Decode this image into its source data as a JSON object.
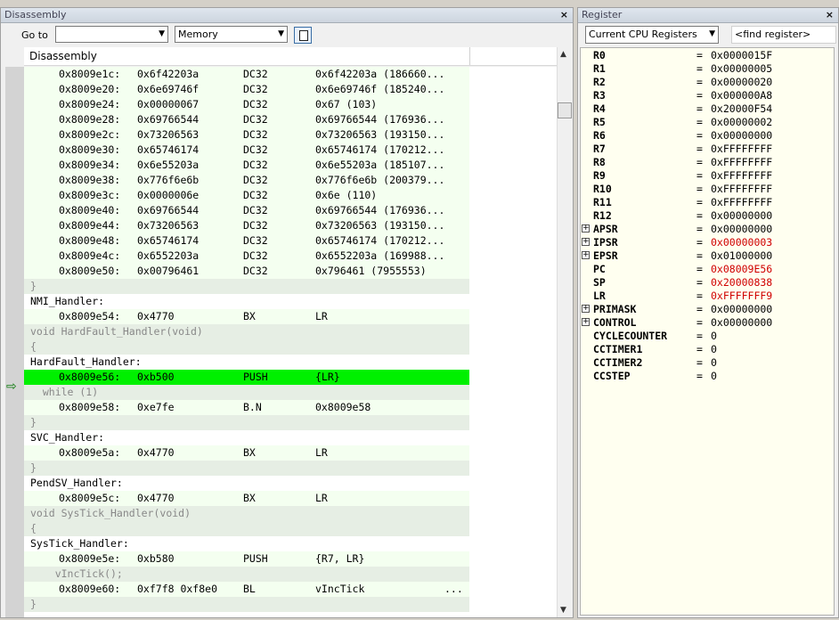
{
  "disassembly": {
    "title": "Disassembly",
    "goto_label": "Go to",
    "goto_value": "",
    "memory_combo": "Memory",
    "column_header": "Disassembly",
    "lines": [
      {
        "kind": "asm",
        "addr": "0x8009e1c:",
        "code": "0x6f42203a",
        "op": "DC32",
        "args": "0x6f42203a (186660..."
      },
      {
        "kind": "asm",
        "addr": "0x8009e20:",
        "code": "0x6e69746f",
        "op": "DC32",
        "args": "0x6e69746f (185240..."
      },
      {
        "kind": "asm",
        "addr": "0x8009e24:",
        "code": "0x00000067",
        "op": "DC32",
        "args": "0x67 (103)"
      },
      {
        "kind": "asm",
        "addr": "0x8009e28:",
        "code": "0x69766544",
        "op": "DC32",
        "args": "0x69766544 (176936..."
      },
      {
        "kind": "asm",
        "addr": "0x8009e2c:",
        "code": "0x73206563",
        "op": "DC32",
        "args": "0x73206563 (193150..."
      },
      {
        "kind": "asm",
        "addr": "0x8009e30:",
        "code": "0x65746174",
        "op": "DC32",
        "args": "0x65746174 (170212..."
      },
      {
        "kind": "asm",
        "addr": "0x8009e34:",
        "code": "0x6e55203a",
        "op": "DC32",
        "args": "0x6e55203a (185107..."
      },
      {
        "kind": "asm",
        "addr": "0x8009e38:",
        "code": "0x776f6e6b",
        "op": "DC32",
        "args": "0x776f6e6b (200379..."
      },
      {
        "kind": "asm",
        "addr": "0x8009e3c:",
        "code": "0x0000006e",
        "op": "DC32",
        "args": "0x6e (110)"
      },
      {
        "kind": "asm",
        "addr": "0x8009e40:",
        "code": "0x69766544",
        "op": "DC32",
        "args": "0x69766544 (176936..."
      },
      {
        "kind": "asm",
        "addr": "0x8009e44:",
        "code": "0x73206563",
        "op": "DC32",
        "args": "0x73206563 (193150..."
      },
      {
        "kind": "asm",
        "addr": "0x8009e48:",
        "code": "0x65746174",
        "op": "DC32",
        "args": "0x65746174 (170212..."
      },
      {
        "kind": "asm",
        "addr": "0x8009e4c:",
        "code": "0x6552203a",
        "op": "DC32",
        "args": "0x6552203a (169988..."
      },
      {
        "kind": "asm",
        "addr": "0x8009e50:",
        "code": "0x00796461",
        "op": "DC32",
        "args": "0x796461 (7955553)"
      },
      {
        "kind": "src",
        "text": "}"
      },
      {
        "kind": "lbl",
        "text": "NMI_Handler:"
      },
      {
        "kind": "asm",
        "addr": "0x8009e54:",
        "code": "0x4770",
        "op": "BX",
        "args": "LR"
      },
      {
        "kind": "src",
        "text": "void HardFault_Handler(void)"
      },
      {
        "kind": "src",
        "text": "{"
      },
      {
        "kind": "lbl",
        "text": "HardFault_Handler:"
      },
      {
        "kind": "cur",
        "addr": "0x8009e56:",
        "code": "0xb500",
        "op": "PUSH",
        "args": "{LR}"
      },
      {
        "kind": "src",
        "text": "  while (1)"
      },
      {
        "kind": "asm",
        "addr": "0x8009e58:",
        "code": "0xe7fe",
        "op": "B.N",
        "args": "0x8009e58"
      },
      {
        "kind": "src",
        "text": "}"
      },
      {
        "kind": "lbl",
        "text": "SVC_Handler:"
      },
      {
        "kind": "asm",
        "addr": "0x8009e5a:",
        "code": "0x4770",
        "op": "BX",
        "args": "LR"
      },
      {
        "kind": "src",
        "text": "}"
      },
      {
        "kind": "lbl",
        "text": "PendSV_Handler:"
      },
      {
        "kind": "asm",
        "addr": "0x8009e5c:",
        "code": "0x4770",
        "op": "BX",
        "args": "LR"
      },
      {
        "kind": "src",
        "text": "void SysTick_Handler(void)"
      },
      {
        "kind": "src",
        "text": "{"
      },
      {
        "kind": "lbl",
        "text": "SysTick_Handler:"
      },
      {
        "kind": "asm",
        "addr": "0x8009e5e:",
        "code": "0xb580",
        "op": "PUSH",
        "args": "{R7, LR}"
      },
      {
        "kind": "src",
        "text": "    vIncTick();"
      },
      {
        "kind": "asm",
        "addr": "0x8009e60:",
        "code": "0xf7f8 0xf8e0",
        "op": "BL",
        "args": "vIncTick",
        "more": "..."
      },
      {
        "kind": "src",
        "text": "}"
      }
    ]
  },
  "register": {
    "title": "Register",
    "group_combo": "Current CPU Registers",
    "find_placeholder": "<find register>",
    "rows": [
      {
        "name": "R0",
        "value": "0x0000015F",
        "expandable": false,
        "changed": false
      },
      {
        "name": "R1",
        "value": "0x00000005",
        "expandable": false,
        "changed": false
      },
      {
        "name": "R2",
        "value": "0x00000020",
        "expandable": false,
        "changed": false
      },
      {
        "name": "R3",
        "value": "0x000000A8",
        "expandable": false,
        "changed": false
      },
      {
        "name": "R4",
        "value": "0x20000F54",
        "expandable": false,
        "changed": false
      },
      {
        "name": "R5",
        "value": "0x00000002",
        "expandable": false,
        "changed": false
      },
      {
        "name": "R6",
        "value": "0x00000000",
        "expandable": false,
        "changed": false
      },
      {
        "name": "R7",
        "value": "0xFFFFFFFF",
        "expandable": false,
        "changed": false
      },
      {
        "name": "R8",
        "value": "0xFFFFFFFF",
        "expandable": false,
        "changed": false
      },
      {
        "name": "R9",
        "value": "0xFFFFFFFF",
        "expandable": false,
        "changed": false
      },
      {
        "name": "R10",
        "value": "0xFFFFFFFF",
        "expandable": false,
        "changed": false
      },
      {
        "name": "R11",
        "value": "0xFFFFFFFF",
        "expandable": false,
        "changed": false
      },
      {
        "name": "R12",
        "value": "0x00000000",
        "expandable": false,
        "changed": false
      },
      {
        "name": "APSR",
        "value": "0x00000000",
        "expandable": true,
        "changed": false
      },
      {
        "name": "IPSR",
        "value": "0x00000003",
        "expandable": true,
        "changed": true
      },
      {
        "name": "EPSR",
        "value": "0x01000000",
        "expandable": true,
        "changed": false
      },
      {
        "name": "PC",
        "value": "0x08009E56",
        "expandable": false,
        "changed": true
      },
      {
        "name": "SP",
        "value": "0x20000838",
        "expandable": false,
        "changed": true
      },
      {
        "name": "LR",
        "value": "0xFFFFFFF9",
        "expandable": false,
        "changed": true
      },
      {
        "name": "PRIMASK",
        "value": "0x00000000",
        "expandable": true,
        "changed": false
      },
      {
        "name": "CONTROL",
        "value": "0x00000000",
        "expandable": true,
        "changed": false
      },
      {
        "name": "CYCLECOUNTER",
        "value": "0",
        "expandable": false,
        "changed": false
      },
      {
        "name": "CCTIMER1",
        "value": "0",
        "expandable": false,
        "changed": false
      },
      {
        "name": "CCTIMER2",
        "value": "0",
        "expandable": false,
        "changed": false
      },
      {
        "name": "CCSTEP",
        "value": "0",
        "expandable": false,
        "changed": false
      }
    ]
  },
  "icons": {
    "close": "close-icon",
    "dropdown": "chevron-down-icon",
    "document": "document-icon",
    "current_pc": "arrow-right-icon",
    "expand": "plus-box-icon"
  },
  "colors": {
    "current_line": "#00f000",
    "changed_value": "#d00000",
    "asm_bg": "#f4fff0",
    "src_bg": "#e6eee4",
    "reg_bg": "#fffff0"
  }
}
